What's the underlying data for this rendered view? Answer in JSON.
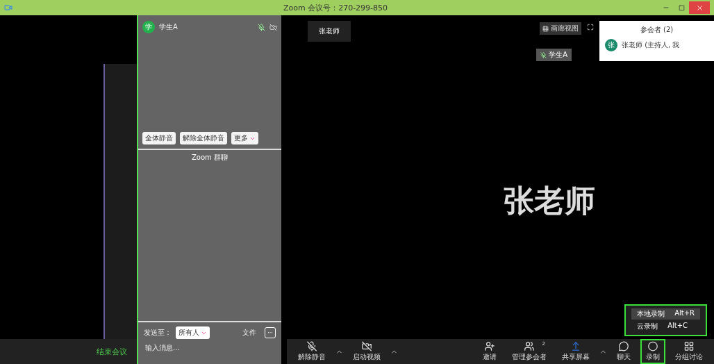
{
  "window": {
    "title": "Zoom 会议号：270-299-850"
  },
  "top_strip": {
    "view_button": "画廊视图",
    "host_thumbnail": "张老师",
    "student_tile": "学生A"
  },
  "participants_panel": {
    "title": "参会者 (2)",
    "items": [
      {
        "avatar": "张",
        "name": "张老师 (主持人, 我"
      }
    ]
  },
  "side_panel": {
    "participants": [
      {
        "avatar": "学",
        "name": "学生A",
        "muted": true
      }
    ],
    "buttons": [
      {
        "label": "全体静音",
        "dropdown": false
      },
      {
        "label": "解除全体静音",
        "dropdown": false
      },
      {
        "label": "更多",
        "dropdown": true
      }
    ],
    "chat": {
      "title": "Zoom 群聊",
      "send_to_label": "发送至：",
      "recipient": "所有人",
      "file_button": "文件",
      "more_button": "···",
      "placeholder": "输入消息..."
    }
  },
  "video": {
    "speaker_name": "张老师"
  },
  "record_menu": [
    {
      "label": "本地录制",
      "shortcut": "Alt+R",
      "selected": true
    },
    {
      "label": "云录制",
      "shortcut": "Alt+C",
      "selected": false
    }
  ],
  "end_button": "结束会议",
  "toolbar": [
    {
      "kind": "mic",
      "label": "解除静音",
      "caret": true
    },
    {
      "kind": "video",
      "label": "启动视频",
      "caret": true
    },
    {
      "kind": "spacer"
    },
    {
      "kind": "invite",
      "label": "邀请",
      "caret": false
    },
    {
      "kind": "participants",
      "label": "管理参会者",
      "count": "2",
      "caret": false
    },
    {
      "kind": "share",
      "label": "共享屏幕",
      "caret": true
    },
    {
      "kind": "chat",
      "label": "聊天",
      "caret": false
    },
    {
      "kind": "record",
      "label": "录制",
      "caret": false,
      "active": true
    },
    {
      "kind": "breakout",
      "label": "分组讨论",
      "caret": false
    }
  ]
}
